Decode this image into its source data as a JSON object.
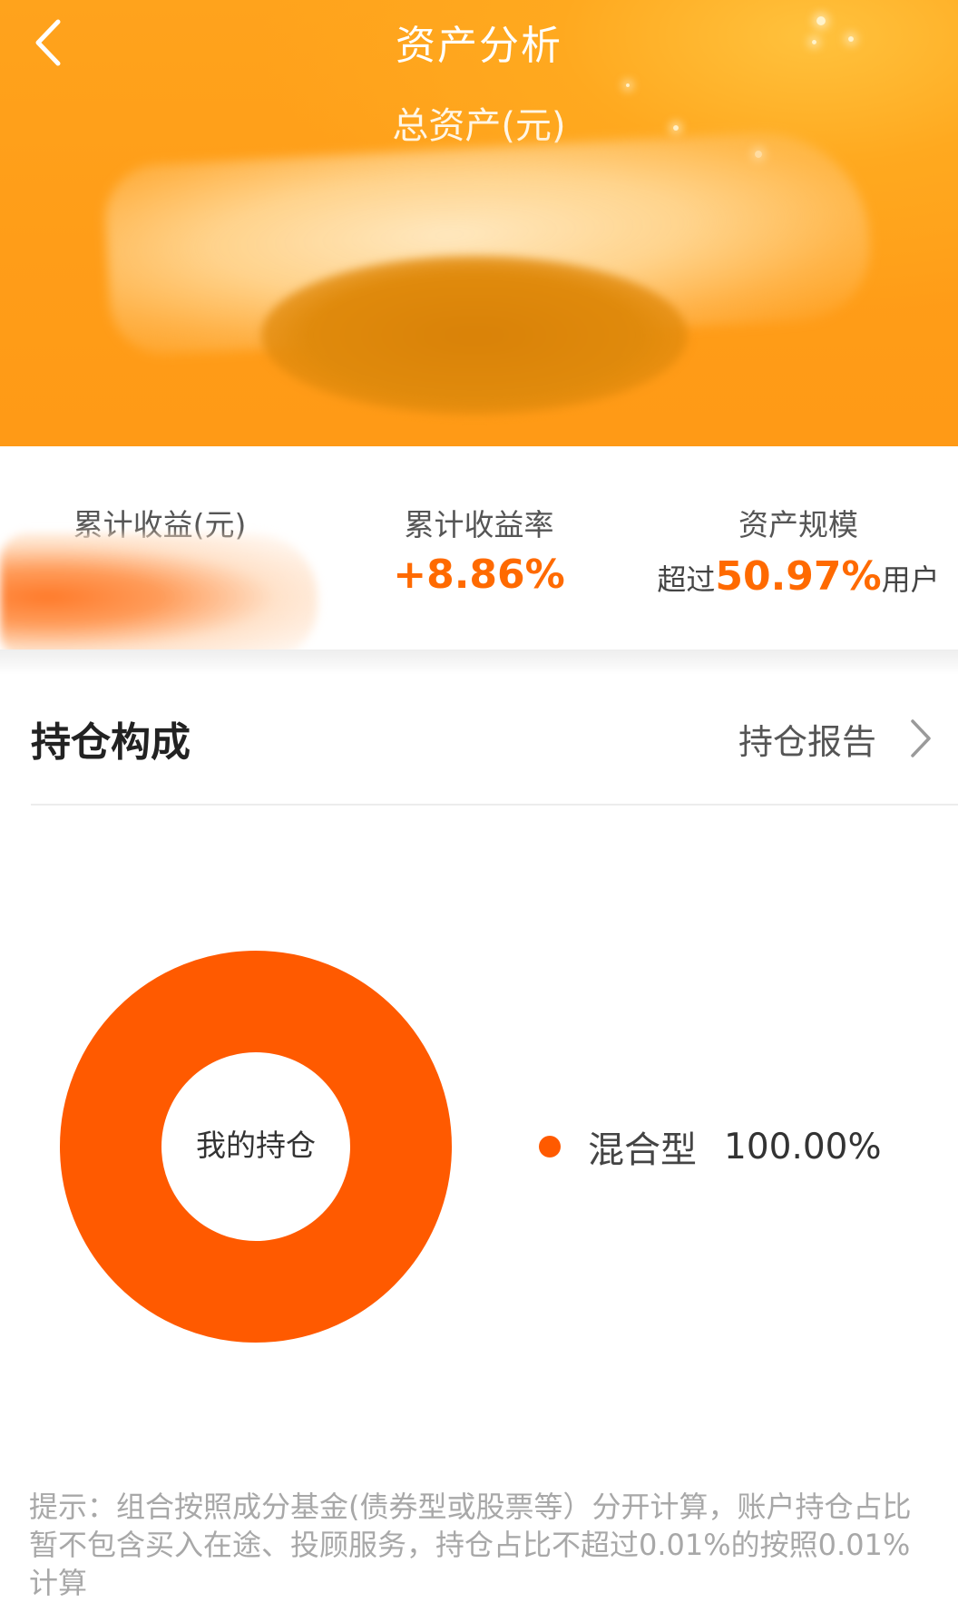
{
  "header": {
    "title": "资产分析",
    "total_asset_label": "总资产(元)",
    "back_icon": "chevron-left-icon"
  },
  "stats": {
    "cumulative_income": {
      "label": "累计收益(元)"
    },
    "cumulative_return_rate": {
      "label": "累计收益率",
      "value": "+8.86%"
    },
    "asset_scale": {
      "label": "资产规模",
      "prefix": "超过",
      "value": "50.97%",
      "suffix": "用户"
    }
  },
  "holdings": {
    "title": "持仓构成",
    "report_link": "持仓报告",
    "report_icon": "chevron-right-icon",
    "donut_center_label": "我的持仓",
    "legend": [
      {
        "name": "混合型",
        "value": "100.00%",
        "color": "#ff5a00"
      }
    ]
  },
  "chart_data": {
    "type": "pie",
    "categories": [
      "混合型"
    ],
    "values": [
      100.0
    ],
    "title": "",
    "center_label": "我的持仓",
    "colors": [
      "#ff5a00"
    ],
    "legend_placement": "right"
  },
  "footnote": "提示：组合按照成分基金(债券型或股票等）分开计算，账户持仓占比暂不包含买入在途、投顾服务，持仓占比不超过0.01%的按照0.01%计算",
  "colors": {
    "header_orange": "#ffa31c",
    "accent": "#ff6a00",
    "donut": "#ff5a00"
  }
}
